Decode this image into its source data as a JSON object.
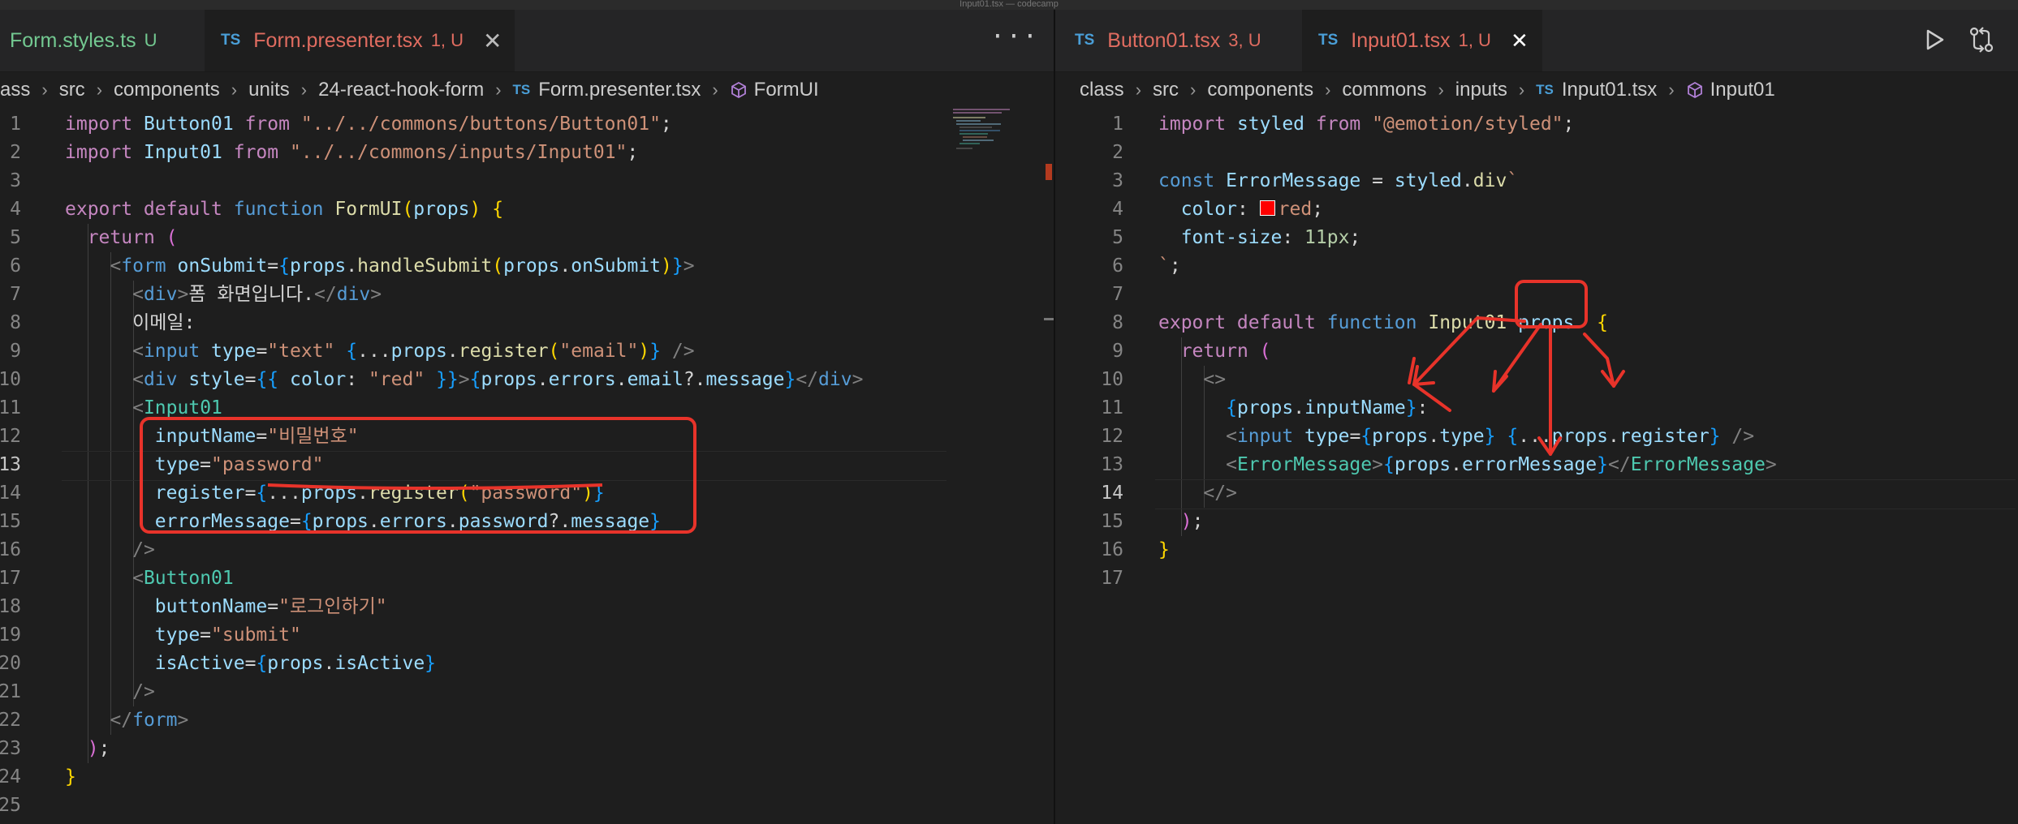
{
  "window": {
    "title": "Input01.tsx — codecamp"
  },
  "left": {
    "tabs": [
      {
        "name": "Form.styles.ts",
        "badge": "U",
        "status": "untracked"
      },
      {
        "name": "Form.presenter.tsx",
        "badge": "1, U",
        "status": "error",
        "lang": "TS"
      }
    ],
    "more_label": "···",
    "breadcrumb": [
      "ass",
      "src",
      "components",
      "units",
      "24-react-hook-form",
      "Form.presenter.tsx",
      "FormUI"
    ],
    "breadcrumb_icon_ts": "TS",
    "current_line": 13,
    "lines": [
      {
        "n": "1",
        "t": [
          [
            "kw",
            "import "
          ],
          [
            "var",
            "Button01"
          ],
          [
            "kw",
            " from "
          ],
          [
            "str",
            "\"../../commons/buttons/Button01\""
          ],
          [
            "pl",
            ";"
          ]
        ]
      },
      {
        "n": "2",
        "t": [
          [
            "kw",
            "import "
          ],
          [
            "var",
            "Input01"
          ],
          [
            "kw",
            " from "
          ],
          [
            "str",
            "\"../../commons/inputs/Input01\""
          ],
          [
            "pl",
            ";"
          ]
        ]
      },
      {
        "n": "3",
        "t": []
      },
      {
        "n": "4",
        "t": [
          [
            "kw",
            "export default "
          ],
          [
            "kb",
            "function "
          ],
          [
            "fn",
            "FormUI"
          ],
          [
            "br",
            "("
          ],
          [
            "var",
            "props"
          ],
          [
            "br",
            ")"
          ],
          [
            "pl",
            " "
          ],
          [
            "br",
            "{"
          ]
        ]
      },
      {
        "n": "5",
        "t": [
          [
            "pl",
            "  "
          ],
          [
            "kw",
            "return "
          ],
          [
            "br2",
            "("
          ]
        ]
      },
      {
        "n": "6",
        "t": [
          [
            "pl",
            "    "
          ],
          [
            "tag",
            "<"
          ],
          [
            "kb",
            "form "
          ],
          [
            "var",
            "onSubmit"
          ],
          [
            "pl",
            "="
          ],
          [
            "br3",
            "{"
          ],
          [
            "var",
            "props"
          ],
          [
            "pl",
            "."
          ],
          [
            "fn",
            "handleSubmit"
          ],
          [
            "br",
            "("
          ],
          [
            "var",
            "props"
          ],
          [
            "pl",
            "."
          ],
          [
            "var",
            "onSubmit"
          ],
          [
            "br",
            ")"
          ],
          [
            "br3",
            "}"
          ],
          [
            "tag",
            ">"
          ]
        ]
      },
      {
        "n": "7",
        "t": [
          [
            "pl",
            "      "
          ],
          [
            "tag",
            "<"
          ],
          [
            "kb",
            "div"
          ],
          [
            "tag",
            ">"
          ],
          [
            "pl",
            "폼 화면입니다."
          ],
          [
            "tag",
            "</"
          ],
          [
            "kb",
            "div"
          ],
          [
            "tag",
            ">"
          ]
        ]
      },
      {
        "n": "8",
        "t": [
          [
            "pl",
            "      이메일:"
          ]
        ]
      },
      {
        "n": "9",
        "t": [
          [
            "pl",
            "      "
          ],
          [
            "tag",
            "<"
          ],
          [
            "kb",
            "input "
          ],
          [
            "var",
            "type"
          ],
          [
            "pl",
            "="
          ],
          [
            "str",
            "\"text\""
          ],
          [
            "pl",
            " "
          ],
          [
            "br3",
            "{"
          ],
          [
            "pl",
            "..."
          ],
          [
            "var",
            "props"
          ],
          [
            "pl",
            "."
          ],
          [
            "fn",
            "register"
          ],
          [
            "br",
            "("
          ],
          [
            "str",
            "\"email\""
          ],
          [
            "br",
            ")"
          ],
          [
            "br3",
            "}"
          ],
          [
            "tag",
            " />"
          ]
        ]
      },
      {
        "n": "10",
        "t": [
          [
            "pl",
            "      "
          ],
          [
            "tag",
            "<"
          ],
          [
            "kb",
            "div "
          ],
          [
            "var",
            "style"
          ],
          [
            "pl",
            "="
          ],
          [
            "br3",
            "{{"
          ],
          [
            "pl",
            " "
          ],
          [
            "var",
            "color"
          ],
          [
            "pl",
            ": "
          ],
          [
            "str",
            "\"red\""
          ],
          [
            "pl",
            " "
          ],
          [
            "br3",
            "}}"
          ],
          [
            "tag",
            ">"
          ],
          [
            "br3",
            "{"
          ],
          [
            "var",
            "props"
          ],
          [
            "pl",
            "."
          ],
          [
            "var",
            "errors"
          ],
          [
            "pl",
            "."
          ],
          [
            "var",
            "email"
          ],
          [
            "pl",
            "?."
          ],
          [
            "var",
            "message"
          ],
          [
            "br3",
            "}"
          ],
          [
            "tag",
            "</"
          ],
          [
            "kb",
            "div"
          ],
          [
            "tag",
            ">"
          ]
        ]
      },
      {
        "n": "11",
        "t": [
          [
            "pl",
            "      "
          ],
          [
            "tag",
            "<"
          ],
          [
            "cls",
            "Input01"
          ]
        ]
      },
      {
        "n": "12",
        "t": [
          [
            "pl",
            "        "
          ],
          [
            "var",
            "inputName"
          ],
          [
            "pl",
            "="
          ],
          [
            "str",
            "\"비밀번호\""
          ]
        ]
      },
      {
        "n": "13",
        "t": [
          [
            "pl",
            "        "
          ],
          [
            "var",
            "type"
          ],
          [
            "pl",
            "="
          ],
          [
            "str",
            "\"password\""
          ]
        ]
      },
      {
        "n": "14",
        "t": [
          [
            "pl",
            "        "
          ],
          [
            "var",
            "register"
          ],
          [
            "pl",
            "="
          ],
          [
            "br3",
            "{"
          ],
          [
            "pl",
            "..."
          ],
          [
            "var",
            "props"
          ],
          [
            "pl",
            "."
          ],
          [
            "fn",
            "register"
          ],
          [
            "br",
            "("
          ],
          [
            "str",
            "\"password\""
          ],
          [
            "br",
            ")"
          ],
          [
            "br3",
            "}"
          ]
        ]
      },
      {
        "n": "15",
        "t": [
          [
            "pl",
            "        "
          ],
          [
            "var",
            "errorMessage"
          ],
          [
            "pl",
            "="
          ],
          [
            "br3",
            "{"
          ],
          [
            "var",
            "props"
          ],
          [
            "pl",
            "."
          ],
          [
            "var",
            "errors"
          ],
          [
            "pl",
            "."
          ],
          [
            "var",
            "password"
          ],
          [
            "pl",
            "?."
          ],
          [
            "var",
            "message"
          ],
          [
            "br3",
            "}"
          ]
        ]
      },
      {
        "n": "16",
        "t": [
          [
            "pl",
            "      "
          ],
          [
            "tag",
            "/>"
          ]
        ]
      },
      {
        "n": "17",
        "t": [
          [
            "pl",
            "      "
          ],
          [
            "tag",
            "<"
          ],
          [
            "cls",
            "Button01"
          ]
        ]
      },
      {
        "n": "18",
        "t": [
          [
            "pl",
            "        "
          ],
          [
            "var",
            "buttonName"
          ],
          [
            "pl",
            "="
          ],
          [
            "str",
            "\"로그인하기\""
          ]
        ]
      },
      {
        "n": "19",
        "t": [
          [
            "pl",
            "        "
          ],
          [
            "var",
            "type"
          ],
          [
            "pl",
            "="
          ],
          [
            "str",
            "\"submit\""
          ]
        ]
      },
      {
        "n": "20",
        "t": [
          [
            "pl",
            "        "
          ],
          [
            "var",
            "isActive"
          ],
          [
            "pl",
            "="
          ],
          [
            "br3",
            "{"
          ],
          [
            "var",
            "props"
          ],
          [
            "pl",
            "."
          ],
          [
            "var",
            "isActive"
          ],
          [
            "br3",
            "}"
          ]
        ]
      },
      {
        "n": "21",
        "t": [
          [
            "pl",
            "      "
          ],
          [
            "tag",
            "/>"
          ]
        ]
      },
      {
        "n": "22",
        "t": [
          [
            "pl",
            "    "
          ],
          [
            "tag",
            "</"
          ],
          [
            "kb",
            "form"
          ],
          [
            "tag",
            ">"
          ]
        ]
      },
      {
        "n": "23",
        "t": [
          [
            "pl",
            "  "
          ],
          [
            "br2",
            ")"
          ],
          [
            "pl",
            ";"
          ]
        ]
      },
      {
        "n": "24",
        "t": [
          [
            "br",
            "}"
          ]
        ]
      },
      {
        "n": "25",
        "t": []
      }
    ]
  },
  "right": {
    "tabs": [
      {
        "name": "Button01.tsx",
        "badge": "3, U",
        "status": "error",
        "lang": "TS"
      },
      {
        "name": "Input01.tsx",
        "badge": "1, U",
        "status": "error",
        "lang": "TS",
        "active": true
      }
    ],
    "close_glyph": "✕",
    "breadcrumb": [
      "class",
      "src",
      "components",
      "commons",
      "inputs",
      "Input01.tsx",
      "Input01"
    ],
    "breadcrumb_icon_ts": "TS",
    "current_line": 14,
    "lines": [
      {
        "n": "1",
        "t": [
          [
            "kw",
            "import "
          ],
          [
            "var",
            "styled"
          ],
          [
            "kw",
            " from "
          ],
          [
            "str",
            "\"@emotion/styled\""
          ],
          [
            "pl",
            ";"
          ]
        ]
      },
      {
        "n": "2",
        "t": []
      },
      {
        "n": "3",
        "t": [
          [
            "kb",
            "const "
          ],
          [
            "var",
            "ErrorMessage"
          ],
          [
            "pl",
            " = "
          ],
          [
            "var",
            "styled"
          ],
          [
            "pl",
            "."
          ],
          [
            "fn",
            "div"
          ],
          [
            "str",
            "`"
          ]
        ]
      },
      {
        "n": "4",
        "t": [
          [
            "pl",
            "  "
          ],
          [
            "var",
            "color"
          ],
          [
            "pl",
            ": "
          ],
          [
            "swatch",
            ""
          ],
          [
            "str",
            "red"
          ],
          [
            "pl",
            ";"
          ]
        ]
      },
      {
        "n": "5",
        "t": [
          [
            "pl",
            "  "
          ],
          [
            "var",
            "font-size"
          ],
          [
            "pl",
            ": "
          ],
          [
            "num",
            "11px"
          ],
          [
            "pl",
            ";"
          ]
        ]
      },
      {
        "n": "6",
        "t": [
          [
            "str",
            "`"
          ],
          [
            "pl",
            ";"
          ]
        ]
      },
      {
        "n": "7",
        "t": []
      },
      {
        "n": "8",
        "t": [
          [
            "kw",
            "export default "
          ],
          [
            "kb",
            "function "
          ],
          [
            "fn",
            "Input01"
          ],
          [
            "pl",
            " "
          ],
          [
            "var",
            "props"
          ],
          [
            "pl",
            "  "
          ],
          [
            "br",
            "{"
          ]
        ]
      },
      {
        "n": "9",
        "t": [
          [
            "pl",
            "  "
          ],
          [
            "kw",
            "return "
          ],
          [
            "br2",
            "("
          ]
        ]
      },
      {
        "n": "10",
        "t": [
          [
            "pl",
            "    "
          ],
          [
            "tag",
            "<>"
          ]
        ]
      },
      {
        "n": "11",
        "t": [
          [
            "pl",
            "      "
          ],
          [
            "br3",
            "{"
          ],
          [
            "var",
            "props"
          ],
          [
            "pl",
            "."
          ],
          [
            "var",
            "inputName"
          ],
          [
            "br3",
            "}"
          ],
          [
            "pl",
            ":"
          ]
        ]
      },
      {
        "n": "12",
        "t": [
          [
            "pl",
            "      "
          ],
          [
            "tag",
            "<"
          ],
          [
            "kb",
            "input "
          ],
          [
            "var",
            "type"
          ],
          [
            "pl",
            "="
          ],
          [
            "br3",
            "{"
          ],
          [
            "var",
            "props"
          ],
          [
            "pl",
            "."
          ],
          [
            "var",
            "type"
          ],
          [
            "br3",
            "}"
          ],
          [
            "pl",
            " "
          ],
          [
            "br3",
            "{"
          ],
          [
            "pl",
            "..."
          ],
          [
            "var",
            "props"
          ],
          [
            "pl",
            "."
          ],
          [
            "var",
            "register"
          ],
          [
            "br3",
            "}"
          ],
          [
            "tag",
            " />"
          ]
        ]
      },
      {
        "n": "13",
        "t": [
          [
            "pl",
            "      "
          ],
          [
            "tag",
            "<"
          ],
          [
            "cls",
            "ErrorMessage"
          ],
          [
            "tag",
            ">"
          ],
          [
            "br3",
            "{"
          ],
          [
            "var",
            "props"
          ],
          [
            "pl",
            "."
          ],
          [
            "var",
            "errorMessage"
          ],
          [
            "br3",
            "}"
          ],
          [
            "tag",
            "</"
          ],
          [
            "cls",
            "ErrorMessage"
          ],
          [
            "tag",
            ">"
          ]
        ]
      },
      {
        "n": "14",
        "t": [
          [
            "pl",
            "    "
          ],
          [
            "tag",
            "</>"
          ]
        ]
      },
      {
        "n": "15",
        "t": [
          [
            "pl",
            "  "
          ],
          [
            "br2",
            ")"
          ],
          [
            "pl",
            ";"
          ]
        ]
      },
      {
        "n": "16",
        "t": [
          [
            "br",
            "}"
          ]
        ]
      },
      {
        "n": "17",
        "t": []
      }
    ]
  },
  "icons": {
    "run": "play-icon",
    "split": "compare-changes-icon"
  },
  "annotation_color": "#e8332a"
}
